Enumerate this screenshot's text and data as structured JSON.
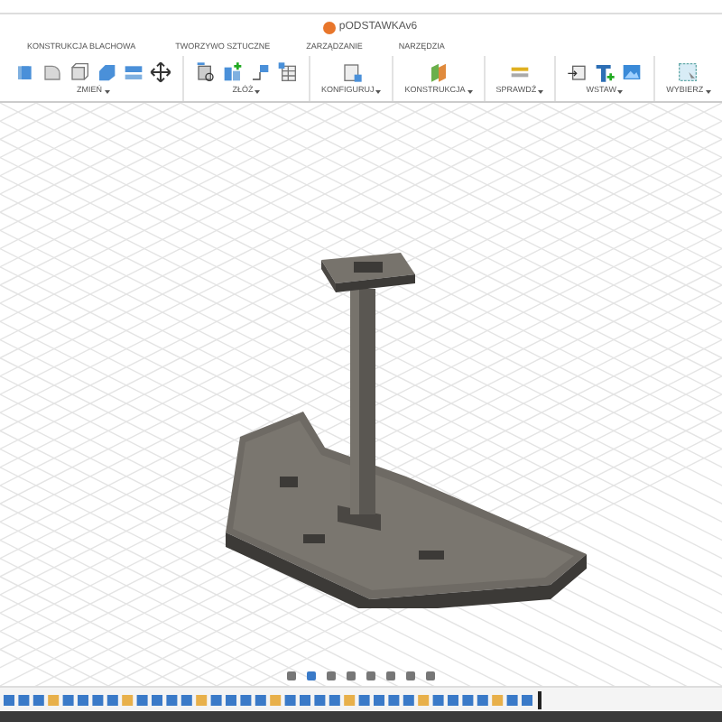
{
  "window": {
    "title": "pODSTAWKAv6"
  },
  "tabs": [
    {
      "label": "KONSTRUKCJA BLACHOWA",
      "selected": false
    },
    {
      "label": "TWORZYWO SZTUCZNE",
      "selected": false
    },
    {
      "label": "ZARZĄDZANIE",
      "selected": false
    },
    {
      "label": "NARZĘDZIA",
      "selected": false
    }
  ],
  "toolbar_groups": [
    {
      "label": "ZMIEŃ"
    },
    {
      "label": "ZŁÓŻ"
    },
    {
      "label": "KONFIGURUJ"
    },
    {
      "label": "KONSTRUKCJA"
    },
    {
      "label": "SPRAWDŹ"
    },
    {
      "label": "WSTAW"
    },
    {
      "label": "WYBIERZ"
    }
  ]
}
